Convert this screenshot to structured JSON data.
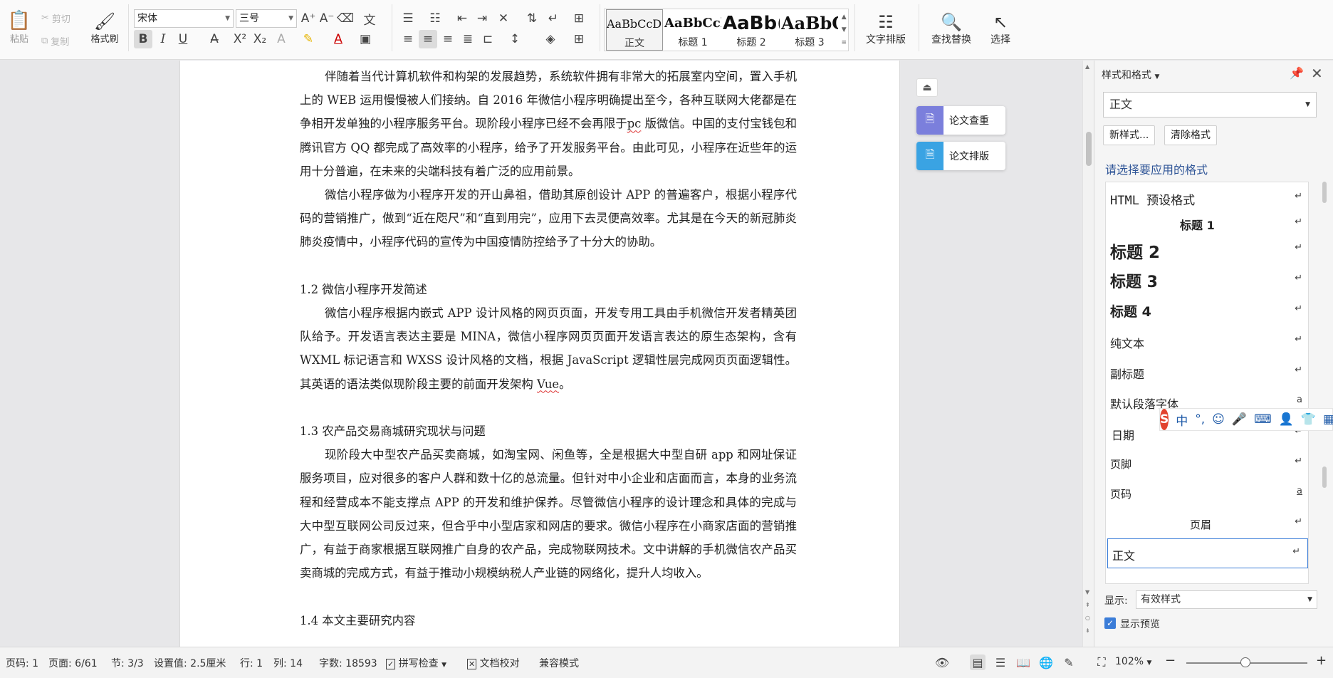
{
  "ribbon": {
    "paste": "粘贴",
    "cut": "剪切",
    "copy": "复制",
    "format_painter": "格式刷",
    "font_name": "宋体",
    "font_size": "三号",
    "text_layout": "文字排版",
    "find_replace": "查找替换",
    "select": "选择",
    "styles": [
      {
        "preview": "AaBbCcDc",
        "label": "正文"
      },
      {
        "preview": "AaBbCcl",
        "label": "标题 1"
      },
      {
        "preview": "AaBb(",
        "label": "标题 2"
      },
      {
        "preview": "AaBbC",
        "label": "标题 3"
      }
    ]
  },
  "floating": {
    "check": "论文查重",
    "format": "论文排版"
  },
  "document": {
    "p1a": "伴随着当代计算机软件和构架的发展趋势，系统软件拥有非常大的拓展室内空间，置入手机上的 WEB 运用慢慢被人们接纳。自 2016 年微信小程序明确提出至今，各种互联网大佬都是在争相开发单独的小程序服务平台。现阶段小程序已经不会再限于",
    "p1_pc": "pc",
    "p1b": " 版微信。中国的支付宝钱包和腾讯官方 QQ 都完成了高效率的小程序，给予了开发服务平台。由此可见，小程序在近些年的运用十分普遍，在未来的尖端科技有着广泛的应用前景。",
    "p2": "微信小程序做为小程序开发的开山鼻祖，借助其原创设计 APP 的普遍客户，根据小程序代码的营销推广，做到“近在咫尺”和“直到用完”，应用下去灵便高效率。尤其是在今天的新冠肺炎肺炎疫情中，小程序代码的宣传为中国疫情防控给予了十分大的协助。",
    "h12": "1.2 微信小程序开发简述",
    "p3a": "微信小程序根据内嵌式 APP 设计风格的网页页面，开发专用工具由手机微信开发者精英团队给予。开发语言表达主要是 MINA，微信小程序网页页面开发语言表达的原生态架构，含有 WXML 标记语言和 WXSS 设计风格的文档，根据 JavaScript 逻辑性层完成网页页面逻辑性。其英语的语法类似现阶段主要的前面开发架构 ",
    "p3_vue": "Vue",
    "p3b": "。",
    "h13": "1.3  农产品交易商城研究现状与问题",
    "p4": "现阶段大中型农产品买卖商城，如淘宝网、闲鱼等，全是根据大中型自研 app 和网址保证服务项目，应对很多的客户人群和数十亿的总流量。但针对中小企业和店面而言，本身的业务流程和经营成本不能支撑点 APP 的开发和维护保养。尽管微信小程序的设计理念和具体的完成与大中型互联网公司反过来，但合乎中小型店家和网店的要求。微信小程序在小商家店面的营销推广，有益于商家根据互联网推广自身的农产品，完成物联网技术。文中讲解的手机微信农产品买卖商城的完成方式，有益于推动小规模纳税人产业链的网络化，提升人均收入。",
    "h14": "1.4  本文主要研究内容"
  },
  "pane": {
    "title": "样式和格式",
    "current_style": "正文",
    "new_style": "新样式...",
    "clear_format": "清除格式",
    "section_label": "请选择要应用的格式",
    "styles": [
      {
        "name": "HTML  预设格式",
        "mark": "↵"
      },
      {
        "name": "标题  1",
        "mark": "↵"
      },
      {
        "name": "标题  2",
        "mark": "↵"
      },
      {
        "name": "标题  3",
        "mark": "↵"
      },
      {
        "name": "标题  4",
        "mark": "↵"
      },
      {
        "name": "纯文本",
        "mark": "↵"
      },
      {
        "name": "副标题",
        "mark": "↵"
      },
      {
        "name": "默认段落字体",
        "mark": "a"
      },
      {
        "name": "日期",
        "mark": "↵"
      },
      {
        "name": "页脚",
        "mark": "↵"
      },
      {
        "name": "页码",
        "mark": "a"
      },
      {
        "name": "页眉",
        "mark": "↵"
      },
      {
        "name": "正文",
        "mark": "↵"
      }
    ],
    "show_label": "显示:",
    "show_value": "有效样式",
    "preview_label": "显示预览"
  },
  "ime": {
    "chinese": "中"
  },
  "status": {
    "page_code": "页码: 1",
    "page": "页面: 6/61",
    "section": "节: 3/3",
    "setting": "设置值: 2.5厘米",
    "row": "行: 1",
    "col": "列: 14",
    "word_count": "字数: 18593",
    "spell_check": "拼写检查",
    "doc_proof": "文档校对",
    "compat": "兼容模式",
    "zoom": "102%"
  },
  "colors": {
    "accent": "#3b7dd8",
    "check_btn": "#7b7fdc",
    "format_btn": "#3aa3e3",
    "ime_logo": "#e2432f"
  }
}
